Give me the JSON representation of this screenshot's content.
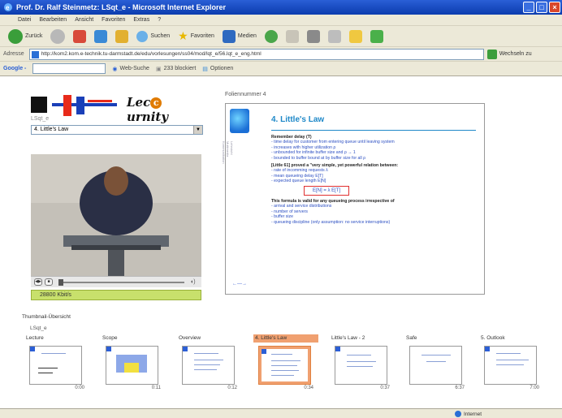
{
  "window": {
    "title": "Prof. Dr. Ralf Steinmetz: LSqt_e - Microsoft Internet Explorer"
  },
  "menu": [
    "Datei",
    "Bearbeiten",
    "Ansicht",
    "Favoriten",
    "Extras",
    "?"
  ],
  "toolbar": {
    "back": "Zurück",
    "search": "Suchen",
    "favorites": "Favoriten",
    "media": "Medien"
  },
  "address": {
    "label": "Adresse",
    "url": "http://kom2.kom.e-technik.tu-darmstadt.de/edu/vorlesungen/ss04/mod/lqt_e/56.lqt_e_eng.html",
    "go": "Wechseln zu"
  },
  "google": {
    "label": "Google -",
    "search_btn": "Web-Suche",
    "blocked": "233 blockiert",
    "options": "Optionen"
  },
  "left": {
    "brand": "Lecturnity",
    "course_label": "LSqt_e",
    "chapter": "4. Little's Law",
    "bandwidth": "28800 Kbit/s"
  },
  "slide": {
    "panel_label": "Foliennummer 4",
    "vertical_text": "Lehrstuhl Multimedia Kommunikation",
    "title": "4. Little's Law",
    "general_label": "Remember delay (T)",
    "bullets1": [
      "- time delay for customer from entering queue until leaving system",
      "- increases with higher utilization ρ",
      "- unbounded for infinite buffer size and ρ → 1",
      "- bounded to buffer bound at by buffer size for all ρ"
    ],
    "little_intro": "[Little 61] proved a \"very simple, yet powerful relation between:",
    "bullets2": [
      "- rate of incomming requests λ",
      "- mean queueing delay E[T]",
      "- expected queue length E[N]"
    ],
    "formula": "E[N] = λ E[T]",
    "valid_intro": "This formula is valid for any queueing process irrespective of",
    "bullets3": [
      "- arrival and service distributions",
      "- number of servers",
      "- buffer size",
      "- queueing discipline (only assumption: no service interruptions)"
    ],
    "nav_arrow": "←—→"
  },
  "thumbs": {
    "title": "Thumbnail-Übersicht",
    "course": "LSqt_e",
    "items": [
      {
        "label": "Lecture",
        "time": "0:00"
      },
      {
        "label": "Scope",
        "time": "0:11"
      },
      {
        "label": "Overview",
        "time": "0:12"
      },
      {
        "label": "4. Little's Law",
        "time": "0:34"
      },
      {
        "label": "Little's Law - 2",
        "time": "0:37"
      },
      {
        "label": "Safe",
        "time": "6:37"
      },
      {
        "label": "5. Outlook",
        "time": "7:00"
      }
    ]
  },
  "status": {
    "zone": "Internet"
  }
}
